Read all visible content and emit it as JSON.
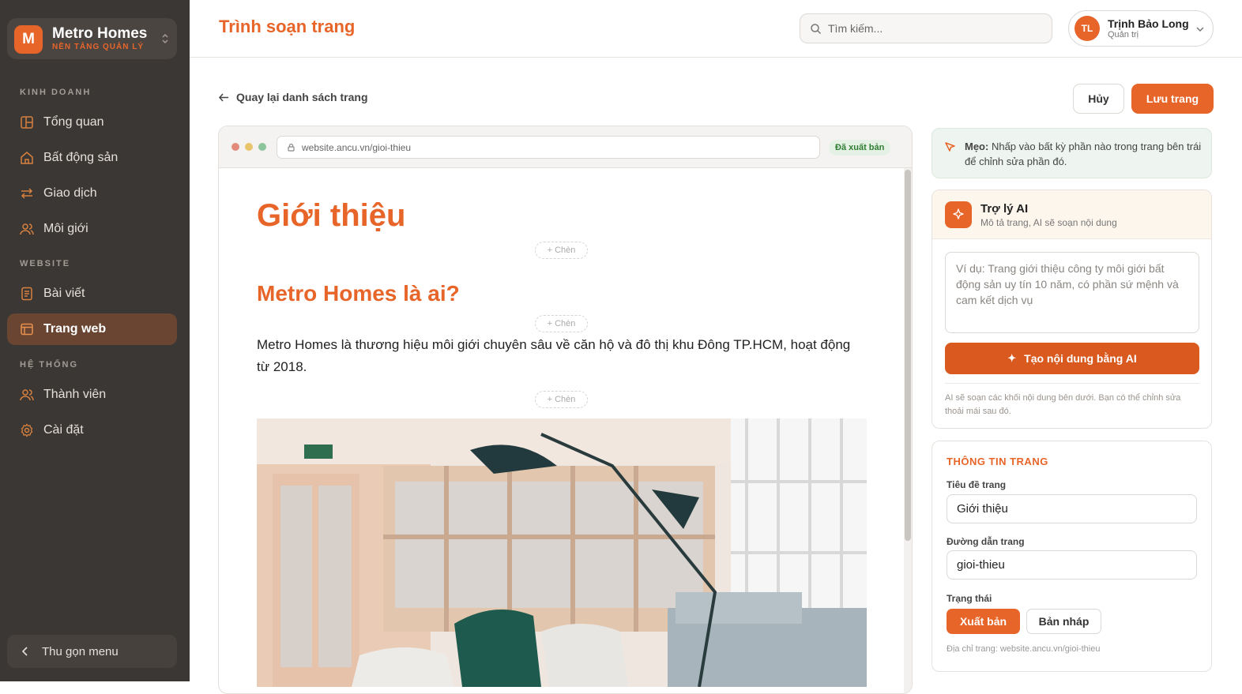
{
  "brand": {
    "logo_letter": "M",
    "name": "Metro Homes",
    "subtitle": "NỀN TẢNG QUẢN LÝ"
  },
  "sidebar": {
    "sections": [
      "KINH DOANH",
      "WEBSITE",
      "HỆ THỐNG"
    ],
    "items": [
      {
        "label": "Tổng quan",
        "icon": "dashboard-icon"
      },
      {
        "label": "Bất động sản",
        "icon": "home-icon"
      },
      {
        "label": "Giao dịch",
        "icon": "transfer-icon"
      },
      {
        "label": "Môi giới",
        "icon": "users-icon"
      },
      {
        "label": "Bài viết",
        "icon": "document-icon"
      },
      {
        "label": "Trang web",
        "icon": "browser-icon",
        "active": true
      },
      {
        "label": "Thành viên",
        "icon": "users-icon"
      },
      {
        "label": "Cài đặt",
        "icon": "gear-icon"
      }
    ],
    "collapse_label": "Thu gọn menu"
  },
  "header": {
    "title": "Trình soạn trang",
    "search_placeholder": "Tìm kiếm...",
    "user": {
      "initials": "TL",
      "name": "Trịnh Bảo Long",
      "role": "Quản trị"
    }
  },
  "toolbar": {
    "back_label": "Quay lại danh sách trang",
    "cancel_label": "Hủy",
    "save_label": "Lưu trang"
  },
  "preview": {
    "url": "website.ancu.vn/gioi-thieu",
    "status_badge": "Đã xuất bản",
    "insert_label": "+ Chèn",
    "heading1": "Giới thiệu",
    "heading2": "Metro Homes là ai?",
    "paragraph": "Metro Homes là thương hiệu môi giới chuyên sâu về căn hộ và đô thị khu Đông TP.HCM, hoạt động từ 2018."
  },
  "tip": {
    "bold": "Mẹo:",
    "text": " Nhấp vào bất kỳ phần nào trong trang bên trái để chỉnh sửa phần đó."
  },
  "ai": {
    "title": "Trợ lý AI",
    "subtitle": "Mô tả trang, AI sẽ soạn nội dung",
    "placeholder": "Ví dụ: Trang giới thiệu công ty môi giới bất động sản uy tín 10 năm, có phần sứ mệnh và cam kết dịch vụ",
    "button_label": "Tạo nội dung bằng AI",
    "note": "AI sẽ soạn các khối nội dung bên dưới. Bạn có thể chỉnh sửa thoải mái sau đó."
  },
  "page_info": {
    "heading": "THÔNG TIN TRANG",
    "title_label": "Tiêu đề trang",
    "title_value": "Giới thiệu",
    "slug_label": "Đường dẫn trang",
    "slug_value": "gioi-thieu",
    "status_label": "Trạng thái",
    "publish_label": "Xuất bản",
    "draft_label": "Bản nháp",
    "address_note": "Địa chỉ trang: website.ancu.vn/gioi-thieu"
  },
  "colors": {
    "accent": "#e8652a",
    "sidebar_bg": "#3a3734",
    "active_bg": "#6a4532",
    "success": "#2e7d32"
  }
}
